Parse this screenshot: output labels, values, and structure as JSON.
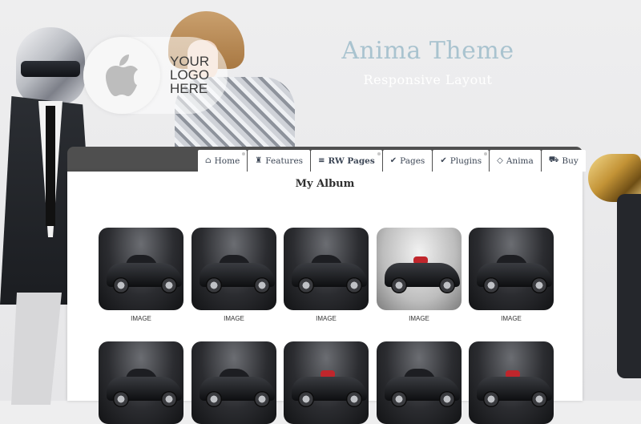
{
  "header": {
    "logo_text": "YOUR\nLOGO\nHERE",
    "site_title": "Anima Theme",
    "site_subtitle": "Responsive Layout"
  },
  "nav": {
    "items": [
      {
        "label": "Home",
        "icon": "home-icon"
      },
      {
        "label": "Features",
        "icon": "trophy-icon"
      },
      {
        "label": "RW Pages",
        "icon": "list-icon"
      },
      {
        "label": "Pages",
        "icon": "check-icon"
      },
      {
        "label": "Plugins",
        "icon": "check-icon"
      },
      {
        "label": "Anima",
        "icon": "diamond-icon"
      },
      {
        "label": "Buy",
        "icon": "cart-icon"
      }
    ]
  },
  "album": {
    "title": "My Album",
    "images": [
      {
        "caption": "IMAGE"
      },
      {
        "caption": "IMAGE"
      },
      {
        "caption": "IMAGE"
      },
      {
        "caption": "IMAGE"
      },
      {
        "caption": "IMAGE"
      },
      {
        "caption": ""
      },
      {
        "caption": ""
      },
      {
        "caption": ""
      },
      {
        "caption": ""
      },
      {
        "caption": ""
      }
    ]
  },
  "colors": {
    "title": "#a9c3cf",
    "nav_text": "#3d4756",
    "panel_bar": "#4f4f4f"
  }
}
